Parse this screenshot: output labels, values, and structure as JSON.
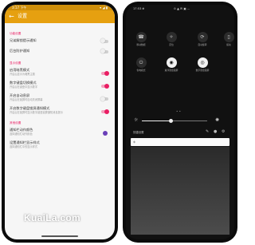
{
  "left_screen": {
    "status": {
      "time": "3:17 下午",
      "right": "▾ ◢ ▮"
    },
    "appbar": {
      "back_icon": "arrow-back-icon",
      "title": "设置"
    },
    "sections": [
      {
        "title": "功能设置",
        "items": [
          {
            "title": "兄弟解锁提示通知",
            "subtitle": "",
            "control": "toggle",
            "state": "off"
          },
          {
            "title": "后台防护通知",
            "subtitle": "",
            "control": "toggle",
            "state": "off"
          }
        ]
      },
      {
        "title": "显示设置",
        "items": [
          {
            "title": "启用暗黑模式",
            "subtitle": "开启后显示为暗黑主题",
            "control": "toggle",
            "state": "on"
          },
          {
            "title": "数字键盘切换模式",
            "subtitle": "开启后在键盘中显示数字",
            "control": "toggle",
            "state": "on"
          },
          {
            "title": "开启自动息屏",
            "subtitle": "开启后在锁屏时自动关闭屏幕",
            "control": "toggle",
            "state": "off"
          },
          {
            "title": "开启数字键盘锁屏通知模式",
            "subtitle": "开启后在锁屏时显示数字键盘锁屏通知消息提示",
            "control": "toggle",
            "state": "on"
          }
        ]
      },
      {
        "title": "其他设置",
        "items": [
          {
            "title": "通知栏动作颜色",
            "subtitle": "选择通知栏动作颜色",
            "control": "radio",
            "state": "selected"
          },
          {
            "title": "设置通知栏显示样式",
            "subtitle": "选择通知栏中的显示样式",
            "control": "none",
            "state": ""
          }
        ]
      }
    ]
  },
  "right_screen": {
    "status": {
      "left": "17:53 ⊕",
      "mid": "⊙ ▲ ✉ ▣ …"
    },
    "tiles": [
      {
        "icon": "phone-icon",
        "glyph": "☎",
        "label": "移动数据",
        "active": false
      },
      {
        "icon": "gps-icon",
        "glyph": "✧",
        "label": "定位",
        "active": false
      },
      {
        "icon": "rotate-icon",
        "glyph": "⟳",
        "label": "自动旋转",
        "active": false
      },
      {
        "icon": "vibrate-icon",
        "glyph": "▯",
        "label": "振动",
        "active": false
      },
      {
        "icon": "power-icon",
        "glyph": "⏻",
        "label": "省电模式",
        "active": false
      },
      {
        "icon": "chat-icon",
        "glyph": "◉",
        "label": "悬浮键盘锁屏",
        "active": true
      },
      {
        "icon": "lock-circle-icon",
        "glyph": "◎",
        "label": "数字键盘锁屏",
        "active": true
      }
    ],
    "page_indicator": "• •",
    "brightness": {
      "value": 0.45
    },
    "footer_text": "快捷设置",
    "watermark": "KuaiLa.com"
  },
  "colors": {
    "appbar": "#e6a010",
    "statusbar": "#cf8f0a",
    "accent_pink": "#e91e63",
    "radio_purple": "#6a3fb8"
  }
}
